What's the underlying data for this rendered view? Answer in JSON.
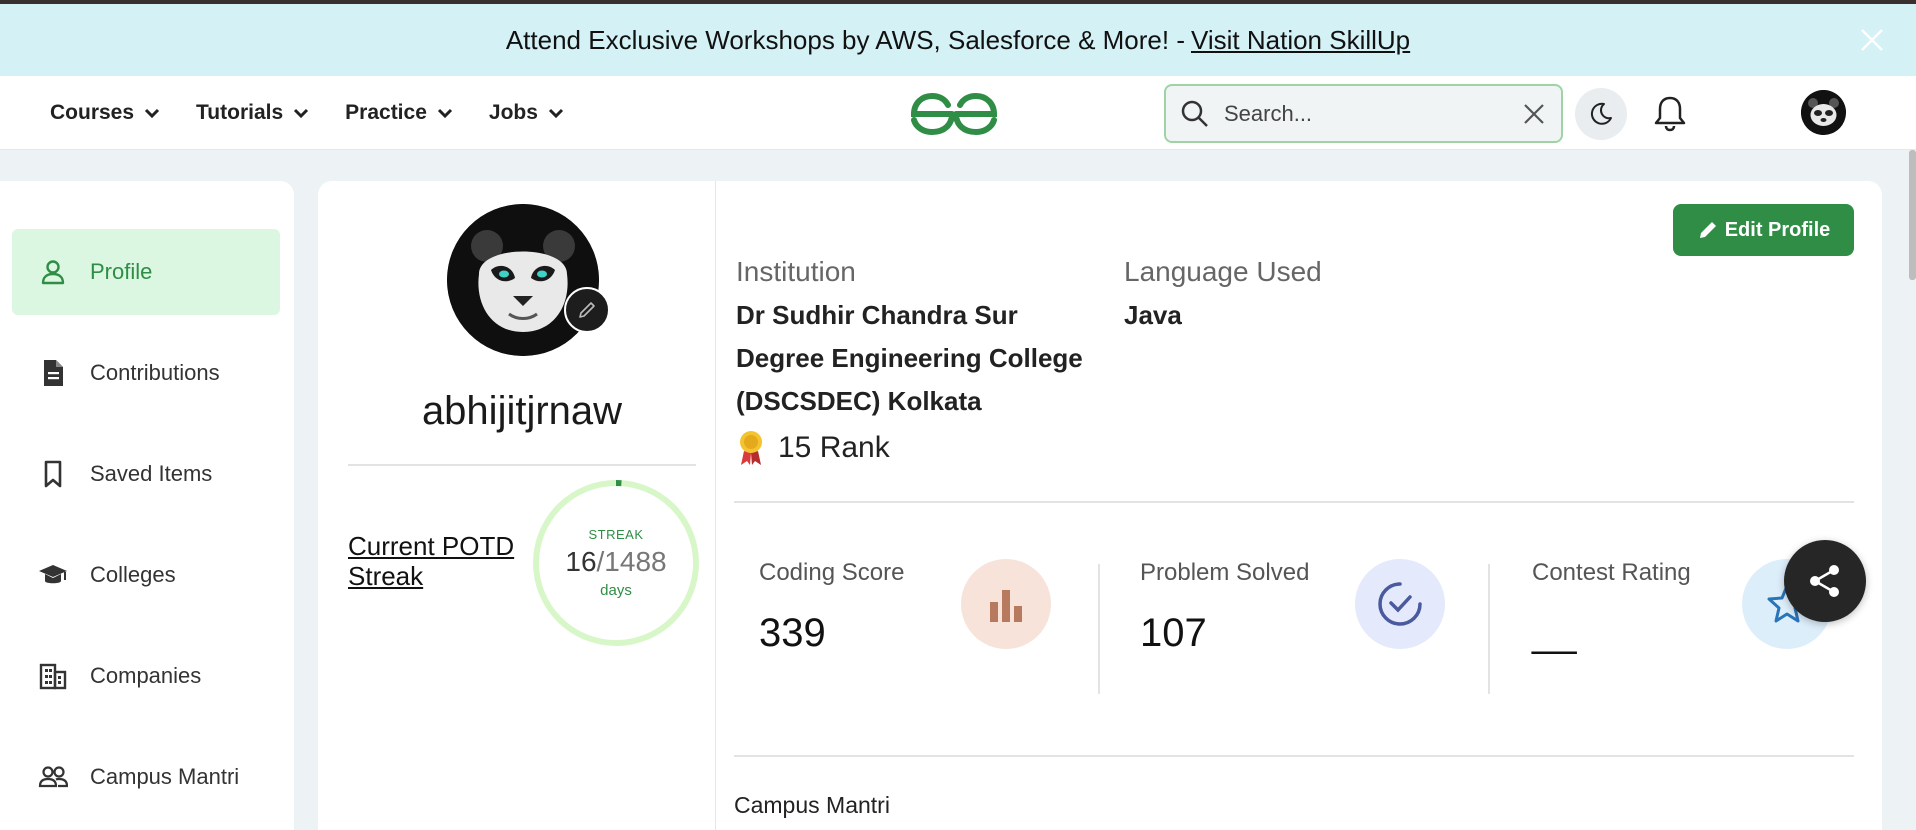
{
  "banner": {
    "text": "Attend Exclusive Workshops by AWS, Salesforce & More! -",
    "link": "Visit Nation SkillUp",
    "close_icon": "close-icon"
  },
  "nav": {
    "items": [
      {
        "label": "Courses",
        "icon": "chevron-down-icon"
      },
      {
        "label": "Tutorials",
        "icon": "chevron-down-icon"
      },
      {
        "label": "Practice",
        "icon": "chevron-down-icon"
      },
      {
        "label": "Jobs",
        "icon": "chevron-down-icon"
      }
    ],
    "logo_icon": "gfg-logo-icon",
    "search": {
      "placeholder": "Search...",
      "value": ""
    },
    "theme_icon": "moon-icon",
    "bell_icon": "bell-icon",
    "avatar_icon": "panda-avatar"
  },
  "sidebar": {
    "items": [
      {
        "label": "Profile",
        "icon": "person-icon",
        "active": true
      },
      {
        "label": "Contributions",
        "icon": "document-icon"
      },
      {
        "label": "Saved Items",
        "icon": "bookmark-icon"
      },
      {
        "label": "Colleges",
        "icon": "graduation-cap-icon"
      },
      {
        "label": "Companies",
        "icon": "building-icon"
      },
      {
        "label": "Campus Mantri",
        "icon": "people-icon"
      }
    ]
  },
  "profile": {
    "username": "abhijitjrnaw",
    "potd_label": "Current POTD Streak",
    "streak": {
      "label": "STREAK",
      "current": "16",
      "total": "/1488",
      "unit": "days",
      "fraction": 0.0108
    },
    "edit_button": "Edit Profile",
    "institution_label": "Institution",
    "institution_lines": [
      "Dr Sudhir Chandra Sur",
      "Degree Engineering College",
      "(DSCSDEC) Kolkata"
    ],
    "language_label": "Language Used",
    "language_value": "Java",
    "rank": "15 Rank",
    "stats": [
      {
        "label": "Coding Score",
        "value": "339",
        "icon": "bar-chart-icon"
      },
      {
        "label": "Problem Solved",
        "value": "107",
        "icon": "check-circle-icon"
      },
      {
        "label": "Contest Rating",
        "value": "__",
        "icon": "star-icon"
      }
    ],
    "campus_mantri": "Campus Mantri"
  },
  "colors": {
    "accent": "#2f8d46",
    "banner_bg": "#d4f1f6",
    "active_bg": "#dcf7e1",
    "streak_track": "#d8f7c8"
  }
}
